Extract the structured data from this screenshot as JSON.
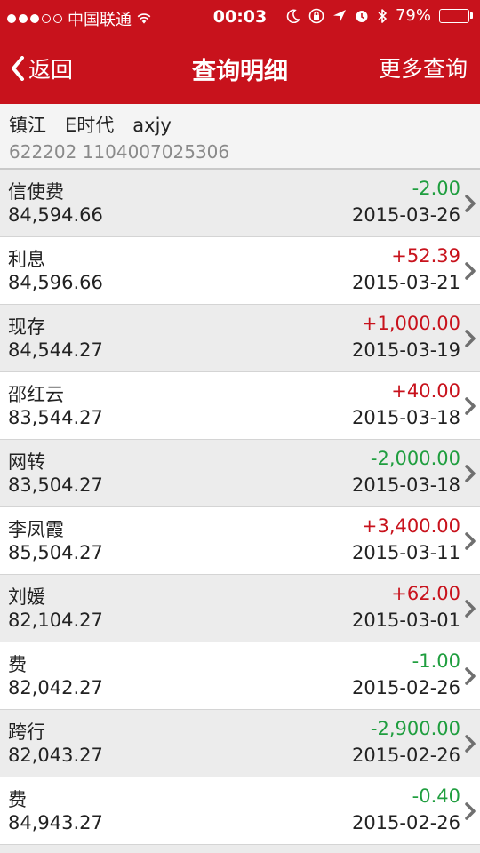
{
  "status_bar": {
    "carrier": "中国联通",
    "time": "00:03",
    "battery_percent": "79%",
    "battery_level": 0.79,
    "icons": [
      "signal-dots-icon",
      "wifi-icon",
      "moon-icon",
      "orientation-lock-icon",
      "location-arrow-icon",
      "alarm-icon",
      "bluetooth-icon",
      "battery-icon"
    ]
  },
  "nav": {
    "back_label": "返回",
    "title": "查询明细",
    "more_label": "更多查询"
  },
  "account": {
    "name": "镇江　E时代　axjy",
    "number": "622202 1104007025306"
  },
  "colors": {
    "brand_red": "#c8121c",
    "debit_green": "#1f9e3f",
    "credit_red": "#c8121c"
  },
  "transactions": [
    {
      "desc": "信使费",
      "balance": "84,594.66",
      "amount": "-2.00",
      "date": "2015-03-26",
      "type": "neg"
    },
    {
      "desc": "利息",
      "balance": "84,596.66",
      "amount": "+52.39",
      "date": "2015-03-21",
      "type": "pos"
    },
    {
      "desc": "现存",
      "balance": "84,544.27",
      "amount": "+1,000.00",
      "date": "2015-03-19",
      "type": "pos"
    },
    {
      "desc": "邵红云",
      "balance": "83,544.27",
      "amount": "+40.00",
      "date": "2015-03-18",
      "type": "pos"
    },
    {
      "desc": "网转",
      "balance": "83,504.27",
      "amount": "-2,000.00",
      "date": "2015-03-18",
      "type": "neg"
    },
    {
      "desc": "李凤霞",
      "balance": "85,504.27",
      "amount": "+3,400.00",
      "date": "2015-03-11",
      "type": "pos"
    },
    {
      "desc": "刘媛",
      "balance": "82,104.27",
      "amount": "+62.00",
      "date": "2015-03-01",
      "type": "pos"
    },
    {
      "desc": "费",
      "balance": "82,042.27",
      "amount": "-1.00",
      "date": "2015-02-26",
      "type": "neg"
    },
    {
      "desc": "跨行",
      "balance": "82,043.27",
      "amount": "-2,900.00",
      "date": "2015-02-26",
      "type": "neg"
    },
    {
      "desc": "费",
      "balance": "84,943.27",
      "amount": "-0.40",
      "date": "2015-02-26",
      "type": "neg"
    }
  ]
}
